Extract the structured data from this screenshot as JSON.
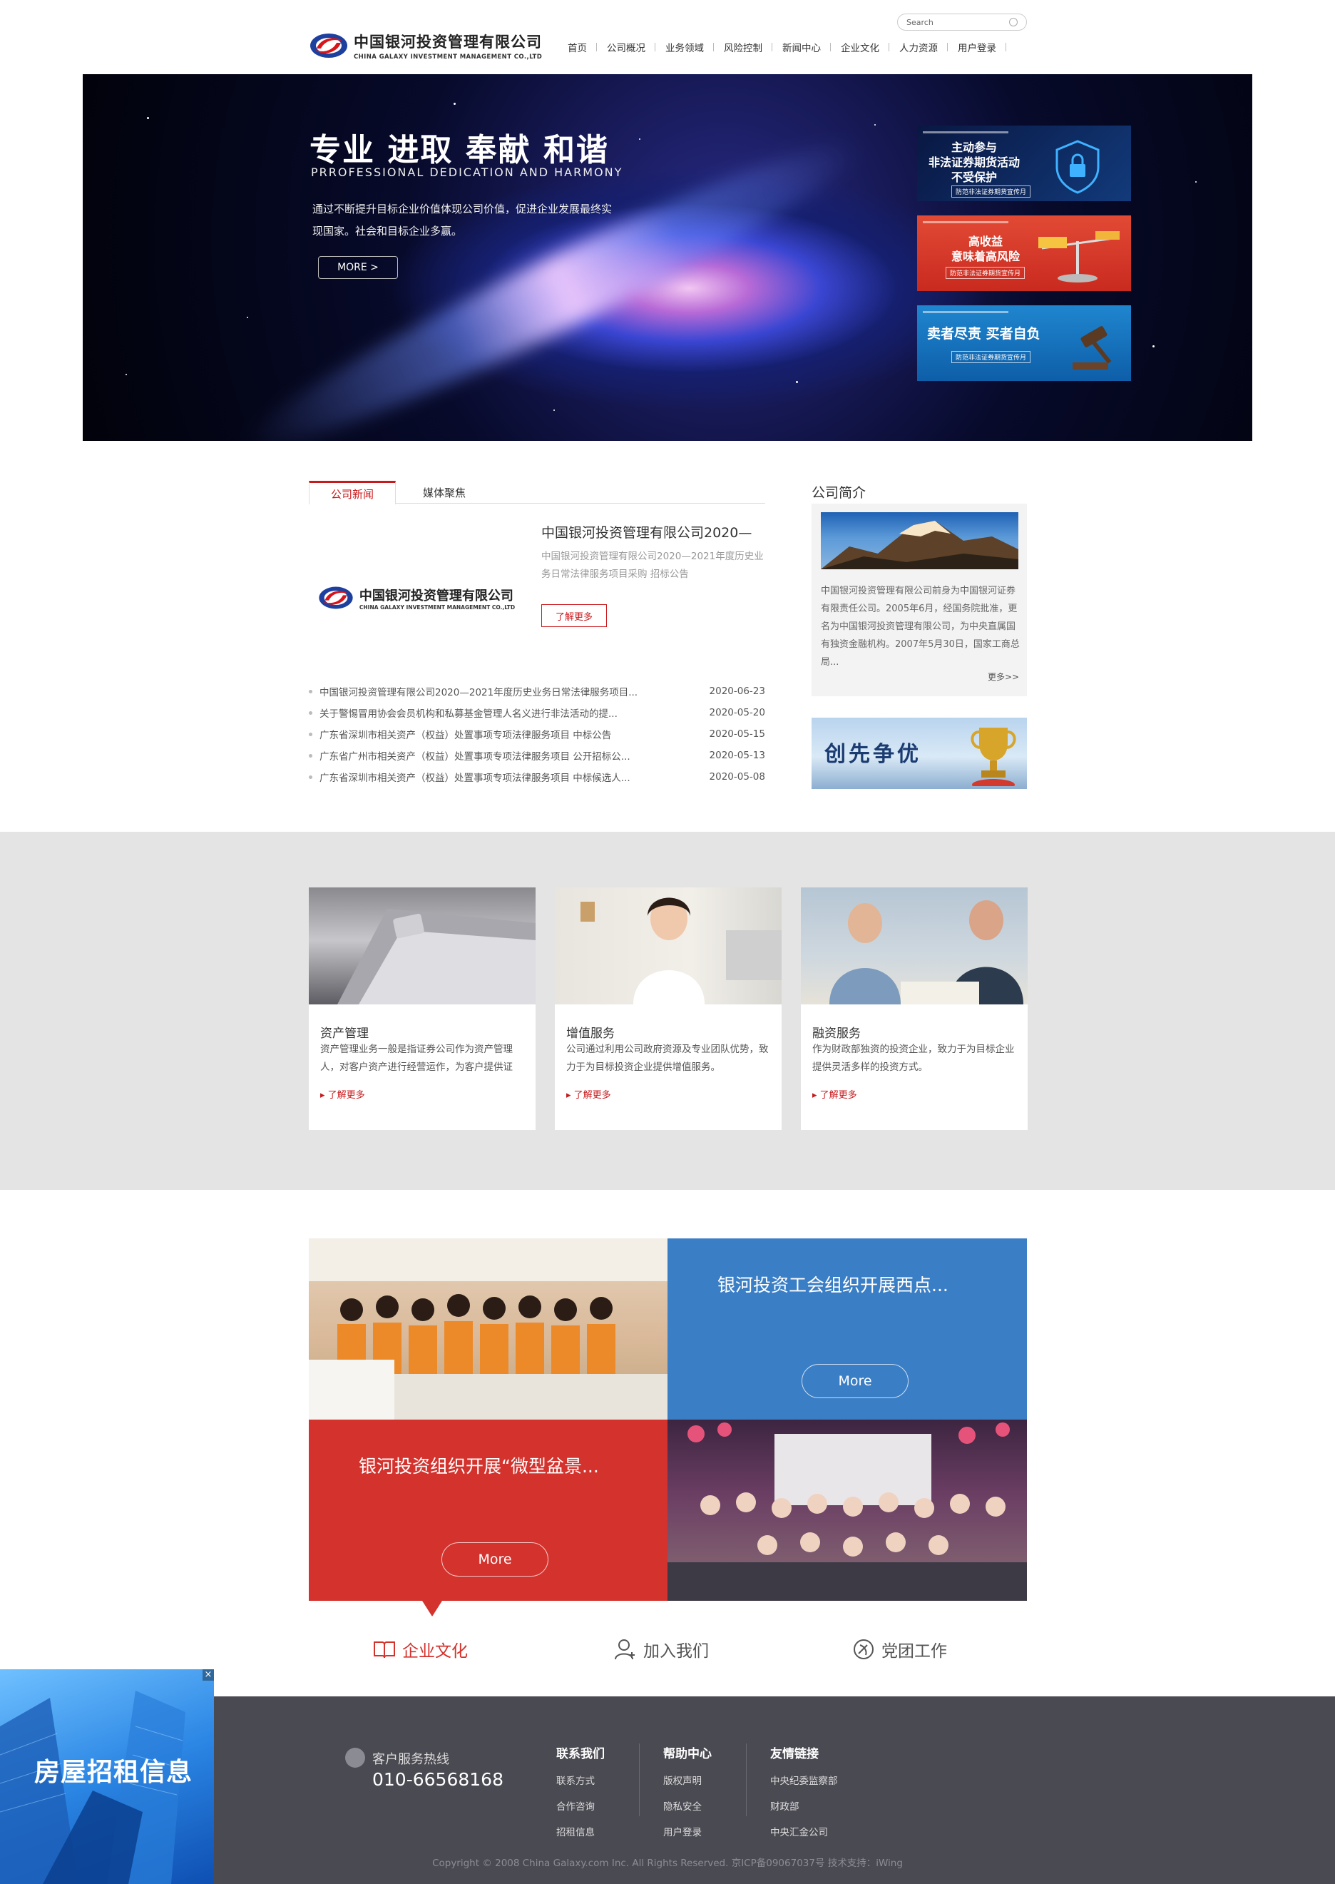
{
  "header": {
    "logo_cn": "中国银河投资管理有限公司",
    "logo_en": "CHINA GALAXY INVESTMENT MANAGEMENT CO.,LTD",
    "search_placeholder": "Search",
    "nav": [
      "首页",
      "公司概况",
      "业务领域",
      "风险控制",
      "新闻中心",
      "企业文化",
      "人力资源",
      "用户登录"
    ]
  },
  "banner": {
    "title": "专业 进取 奉献 和谐",
    "subtitle": "PRROFESSIONAL   DEDICATION  AND  HARMONY",
    "desc": "通过不断提升目标企业价值体现公司价值，促进企业发展最终实现国家。社会和目标企业多赢。",
    "more": "MORE    >",
    "promos": [
      {
        "line1": "主动参与",
        "line2": "非法证券期货活动",
        "line3": "不受保护",
        "tag": "防范非法证券期货宣传月",
        "color": "#0b1f52"
      },
      {
        "line1": "高收益",
        "line2": "意味着高风险",
        "line3": "",
        "tag": "防范非法证券期货宣传月",
        "color": "#d93a2b"
      },
      {
        "line1": "卖者尽责  买者自负",
        "line2": "",
        "line3": "",
        "tag": "防范非法证券期货宣传月",
        "color": "#1772c2"
      }
    ]
  },
  "news": {
    "tabs": [
      "公司新闻",
      "媒体聚焦"
    ],
    "featured_title": "中国银河投资管理有限公司2020—",
    "featured_desc": "中国银河投资管理有限公司2020—2021年度历史业务日常法律服务项目采购 招标公告",
    "featured_btn": "了解更多",
    "items": [
      {
        "title": "中国银河投资管理有限公司2020—2021年度历史业务日常法律服务项目...",
        "date": "2020-06-23"
      },
      {
        "title": "关于警惕冒用协会会员机构和私募基金管理人名义进行非法活动的提...",
        "date": "2020-05-20"
      },
      {
        "title": "广东省深圳市相关资产（权益）处置事项专项法律服务项目 中标公告",
        "date": "2020-05-15"
      },
      {
        "title": "广东省广州市相关资产（权益）处置事项专项法律服务项目 公开招标公...",
        "date": "2020-05-13"
      },
      {
        "title": "广东省深圳市相关资产（权益）处置事项专项法律服务项目 中标候选人...",
        "date": "2020-05-08"
      }
    ]
  },
  "about": {
    "heading": "公司简介",
    "text": "中国银河投资管理有限公司前身为中国银河证券有限责任公司。2005年6月，经国务院批准，更名为中国银河投资管理有限公司，为中央直属国有独资金融机构。2007年5月30日，国家工商总局...",
    "more": "更多>>",
    "banner_text": "创先争优"
  },
  "services": [
    {
      "title": "资产管理",
      "desc": "资产管理业务一般是指证券公司作为资产管理人，对客户资产进行经营运作，为客户提供证",
      "more": "了解更多"
    },
    {
      "title": "增值服务",
      "desc": "公司通过利用公司政府资源及专业团队优势，致力于为目标投资企业提供增值服务。",
      "more": "了解更多"
    },
    {
      "title": "融资服务",
      "desc": "作为财政部独资的投资企业，致力于为目标企业提供灵活多样的投资方式。",
      "more": "了解更多"
    }
  ],
  "culture": {
    "blue_title": "银河投资工会组织开展西点...",
    "red_title": "银河投资组织开展“微型盆景...",
    "more": "More",
    "tabs": [
      "企业文化",
      "加入我们",
      "党团工作"
    ],
    "active_color": "#d3322d",
    "blue": "#3a7ec6"
  },
  "footer": {
    "hotline_label": "客户服务热线",
    "hotline": "010-66568168",
    "cols": [
      {
        "title": "联系我们",
        "items": [
          "联系方式",
          "合作咨询",
          "招租信息"
        ]
      },
      {
        "title": "帮助中心",
        "items": [
          "版权声明",
          "隐私安全",
          "用户登录"
        ]
      },
      {
        "title": "友情链接",
        "items": [
          "中央纪委监察部",
          "财政部",
          "中央汇金公司"
        ]
      }
    ],
    "copyright": "Copyright © 2008 China Galaxy.com Inc. All Rights Reserved. 京ICP备09067037号 技术支持：iWing"
  },
  "ad": {
    "text": "房屋招租信息",
    "close": "×"
  }
}
